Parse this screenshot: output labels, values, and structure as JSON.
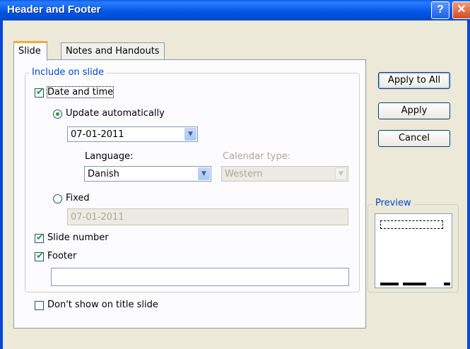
{
  "window": {
    "title": "Header and Footer",
    "help_glyph": "?",
    "close_glyph": "✕"
  },
  "tabs": [
    {
      "label": "Slide",
      "selected": true
    },
    {
      "label": "Notes and Handouts",
      "selected": false
    }
  ],
  "include_group": {
    "title": "Include on slide",
    "date_and_time": {
      "label": "Date and time",
      "checked": true
    },
    "update_automatically": {
      "label": "Update automatically",
      "selected": true
    },
    "date_value": "07-01-2011",
    "language_label": "Language:",
    "language_value": "Danish",
    "calendar_type_label": "Calendar type:",
    "calendar_type_value": "Western",
    "fixed": {
      "label": "Fixed",
      "selected": false
    },
    "fixed_value": "07-01-2011",
    "slide_number": {
      "label": "Slide number",
      "checked": true
    },
    "footer": {
      "label": "Footer",
      "checked": true
    },
    "footer_value": ""
  },
  "dont_show_title": {
    "label": "Don't show on title slide",
    "checked": false
  },
  "buttons": {
    "apply_all": "Apply to All",
    "apply": "Apply",
    "cancel": "Cancel"
  },
  "preview": {
    "title": "Preview"
  },
  "icons": {
    "check": "✔",
    "dropdown": "▼"
  },
  "colors": {
    "titlebar": "#0055e5",
    "accent_label": "#0046d5",
    "check_green": "#21a121",
    "dialog_bg": "#ece9d8"
  }
}
